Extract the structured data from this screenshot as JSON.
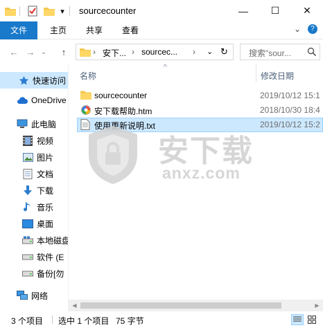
{
  "window": {
    "title": "sourcecounter",
    "controls": {
      "minimize": "—",
      "maximize": "☐",
      "close": "✕"
    },
    "qa_dropdown": "▾"
  },
  "ribbon": {
    "tabs": [
      {
        "label": "文件",
        "active": true
      },
      {
        "label": "主页"
      },
      {
        "label": "共享"
      },
      {
        "label": "查看"
      }
    ],
    "collapse_glyph": "⌄",
    "help_glyph": "?"
  },
  "address": {
    "back": "←",
    "forward": "→",
    "recent": "⌄",
    "up": "↑",
    "segments": [
      "安下...",
      "sourcec..."
    ],
    "separator": "›",
    "dropdown": "⌄",
    "refresh": "↻"
  },
  "search": {
    "placeholder": "搜索\"sour..."
  },
  "nav": {
    "items": [
      {
        "label": "快速访问",
        "icon": "star-icon",
        "selected": true
      },
      {
        "label": "OneDrive",
        "icon": "cloud-icon"
      },
      {
        "label": "此电脑",
        "icon": "computer-icon"
      },
      {
        "label": "视频",
        "icon": "video-icon"
      },
      {
        "label": "图片",
        "icon": "picture-icon"
      },
      {
        "label": "文档",
        "icon": "document-icon"
      },
      {
        "label": "下载",
        "icon": "download-icon"
      },
      {
        "label": "音乐",
        "icon": "music-icon"
      },
      {
        "label": "桌面",
        "icon": "desktop-icon"
      },
      {
        "label": "本地磁盘",
        "icon": "drive-icon"
      },
      {
        "label": "软件 (E",
        "icon": "drive-icon"
      },
      {
        "label": "备份[勿",
        "icon": "drive-icon"
      },
      {
        "label": "网络",
        "icon": "network-icon"
      }
    ]
  },
  "columns": {
    "name": "名称",
    "modified": "修改日期",
    "sort_glyph": "^"
  },
  "files": [
    {
      "name": "sourcecounter",
      "date": "2019/10/12 15:1",
      "type": "folder"
    },
    {
      "name": "安下载帮助.htm",
      "date": "2018/10/30 18:4",
      "type": "html"
    },
    {
      "name": "使用更新说明.txt",
      "date": "2019/10/12 15:2",
      "type": "text",
      "selected": true
    }
  ],
  "watermark": {
    "text": "安下载",
    "sub": "anxz.com"
  },
  "scroll": {
    "left_arrow": "◀",
    "right_arrow": "▶"
  },
  "status": {
    "count": "3 个项目",
    "selection": "选中 1 个项目",
    "size": "75 字节"
  },
  "colors": {
    "accent": "#1979ca",
    "selection_bg": "#cce8ff",
    "selection_border": "#99d1ff",
    "folder": "#f3c74f",
    "header_text": "#4c607a"
  }
}
